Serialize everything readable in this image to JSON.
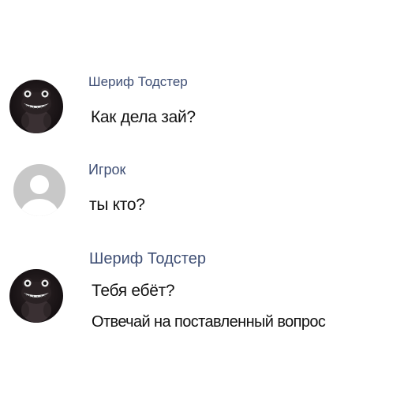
{
  "chat": {
    "messages": [
      {
        "sender": "Шериф Тодстер",
        "avatar_icon": "sheriff-toadster-avatar",
        "lines": [
          "Как дела зай?"
        ]
      },
      {
        "sender": "Игрок",
        "avatar_icon": "default-user-avatar",
        "lines": [
          "ты кто?"
        ]
      },
      {
        "sender": "Шериф Тодстер",
        "avatar_icon": "sheriff-toadster-avatar",
        "lines": [
          "Тебя ебёт?",
          "Отвечай на поставленный вопрос"
        ]
      }
    ]
  },
  "colors": {
    "sender_name": "#3f4f75",
    "message_text": "#121212",
    "background": "#ffffff",
    "default_avatar_bg": "#c8c8c8",
    "default_avatar_fg": "#ffffff"
  }
}
